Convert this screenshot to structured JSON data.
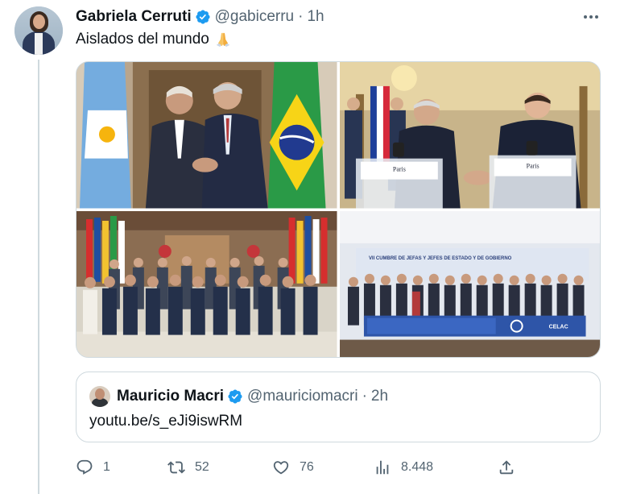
{
  "tweet": {
    "author_name": "Gabriela Cerruti",
    "author_handle": "@gabicerru",
    "separator": "·",
    "time": "1h",
    "text": "Aislados del mundo",
    "emoji": "🙏"
  },
  "media": {
    "photos": [
      {
        "caption": ""
      },
      {
        "caption": ""
      },
      {
        "caption": ""
      },
      {
        "caption": ""
      }
    ],
    "podium_sign": "Paris",
    "banner_text": "VII CUMBRE DE JEFAS Y JEFES DE ESTADO Y DE GOBIERNO",
    "banner_logo": "CELAC"
  },
  "quote": {
    "author_name": "Mauricio Macri",
    "author_handle": "@mauriciomacri",
    "separator": "·",
    "time": "2h",
    "text": "youtu.be/s_eJi9iswRM"
  },
  "actions": {
    "replies": "1",
    "retweets": "52",
    "likes": "76",
    "views": "8.448"
  },
  "colors": {
    "verified": "#1d9bf0",
    "secondary_text": "#536471",
    "border": "#cfd9de"
  }
}
